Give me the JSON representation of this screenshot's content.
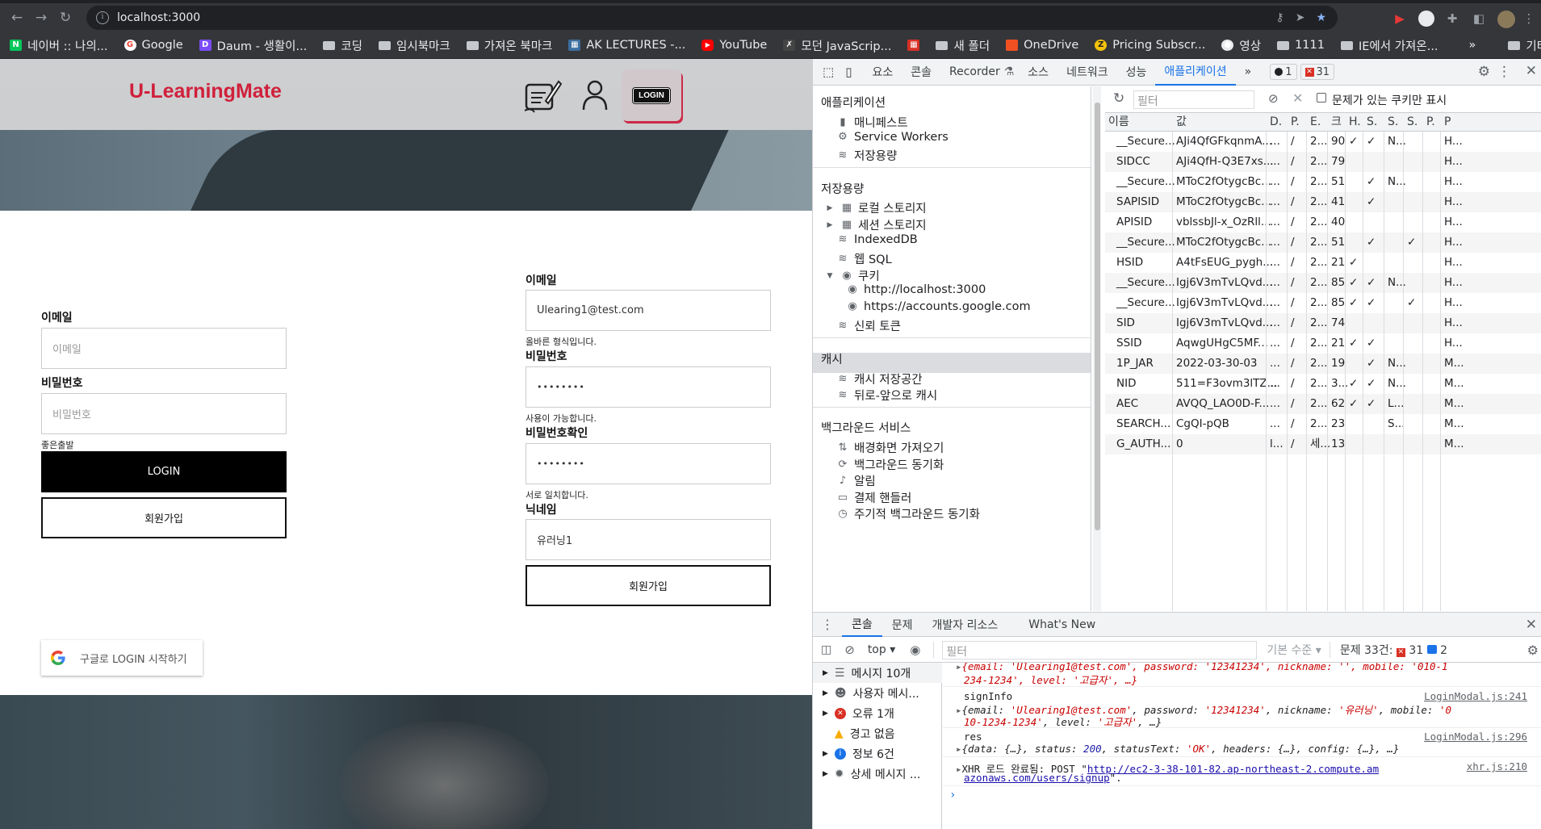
{
  "browser": {
    "url": "localhost:3000",
    "bookmarks": [
      {
        "label": "네이버 :: 나의...",
        "icon": "naver-icon"
      },
      {
        "label": "Google",
        "icon": "google-icon"
      },
      {
        "label": "Daum - 생활이...",
        "icon": "daum-icon"
      },
      {
        "label": "코딩",
        "icon": "folder-icon"
      },
      {
        "label": "임시북마크",
        "icon": "folder-icon"
      },
      {
        "label": "가져온 북마크",
        "icon": "folder-icon"
      },
      {
        "label": "AK LECTURES -...",
        "icon": "ak-icon"
      },
      {
        "label": "YouTube",
        "icon": "youtube-icon"
      },
      {
        "label": "모던 JavaScrip...",
        "icon": "js-icon"
      },
      {
        "label": "",
        "icon": "red-pattern-icon"
      },
      {
        "label": "새 폴더",
        "icon": "folder-icon"
      },
      {
        "label": "OneDrive",
        "icon": "microsoft-icon"
      },
      {
        "label": "Pricing Subscr...",
        "icon": "z-icon"
      },
      {
        "label": "영상",
        "icon": "globe-icon"
      },
      {
        "label": "1111",
        "icon": "folder-icon"
      },
      {
        "label": "IE에서 가져온...",
        "icon": "folder-icon"
      }
    ],
    "more_bookmarks": "»",
    "other_bookmarks": "기타 북마크"
  },
  "site": {
    "logo": "U-LearningMate",
    "login_badge": "LOGIN"
  },
  "login_form": {
    "email_label": "이메일",
    "email_placeholder": "이메일",
    "password_label": "비밀번호",
    "password_placeholder": "비밀번호",
    "hint": "좋은출발",
    "login_button": "LOGIN",
    "signup_button": "회원가입",
    "google_button": "구글로 LOGIN 시작하기"
  },
  "signup_form": {
    "email_label": "이메일",
    "email_value": "Ulearing1@test.com",
    "email_hint": "올바른 형식입니다.",
    "password_label": "비밀번호",
    "password_value": "••••••••",
    "password_hint": "사용이 가능합니다.",
    "confirm_label": "비밀번호확인",
    "confirm_value": "••••••••",
    "confirm_hint": "서로 일치합니다.",
    "nickname_label": "닉네임",
    "nickname_value": "유러닝1",
    "submit_button": "회원가입"
  },
  "devtools": {
    "tabs": [
      "요소",
      "콘솔",
      "Recorder",
      "소스",
      "네트워크",
      "성능",
      "애플리케이션"
    ],
    "active_tab": "애플리케이션",
    "more": "»",
    "info_count": "1",
    "error_count": "31",
    "sidebar": {
      "app_section": "애플리케이션",
      "app_items": [
        "매니페스트",
        "Service Workers",
        "저장용량"
      ],
      "storage_section": "저장용량",
      "storage_items": [
        "로컬 스토리지",
        "세션 스토리지",
        "IndexedDB",
        "웹 SQL",
        "쿠키"
      ],
      "cookie_items": [
        "http://localhost:3000",
        "https://accounts.google.com"
      ],
      "trust_token": "신뢰 토큰",
      "cache_section": "캐시",
      "cache_items": [
        "캐시 저장공간",
        "뒤로-앞으로 캐시"
      ],
      "bg_section": "백그라운드 서비스",
      "bg_items": [
        "배경화면 가져오기",
        "백그라운드 동기화",
        "알림",
        "결제 핸들러",
        "주기적 백그라운드 동기화"
      ]
    },
    "cookies": {
      "filter_placeholder": "필터",
      "only_issues_label": "문제가 있는 쿠키만 표시",
      "columns": [
        "이름",
        "값",
        "D.",
        "P.",
        "E.",
        "크",
        "H.",
        "S.",
        "S.",
        "S.",
        "P.",
        "P"
      ],
      "rows": [
        [
          "__Secure...",
          "AJi4QfGFkqnmA...",
          "...",
          "/",
          "2...",
          "90",
          "✓",
          "✓",
          "N...",
          "",
          "",
          "H..."
        ],
        [
          "SIDCC",
          "AJi4QfH-Q3E7xs...",
          "...",
          "/",
          "2...",
          "79",
          "",
          "",
          "",
          "",
          "",
          "H..."
        ],
        [
          "__Secure...",
          "MToC2fOtygcBc...",
          "...",
          "/",
          "2...",
          "51",
          "",
          "✓",
          "N...",
          "",
          "",
          "H..."
        ],
        [
          "SAPISID",
          "MToC2fOtygcBc...",
          "...",
          "/",
          "2...",
          "41",
          "",
          "✓",
          "",
          "",
          "",
          "H..."
        ],
        [
          "APISID",
          "vblssbJl-x_OzRll...",
          "...",
          "/",
          "2...",
          "40",
          "",
          "",
          "",
          "",
          "",
          "H..."
        ],
        [
          "__Secure...",
          "MToC2fOtygcBc...",
          "...",
          "/",
          "2...",
          "51",
          "",
          "✓",
          "",
          "✓",
          "",
          "H..."
        ],
        [
          "HSID",
          "A4tFsEUG_pygh...",
          "...",
          "/",
          "2...",
          "21",
          "✓",
          "",
          "",
          "",
          "",
          "H..."
        ],
        [
          "__Secure...",
          "Igj6V3mTvLQvd...",
          "...",
          "/",
          "2...",
          "85",
          "✓",
          "✓",
          "N...",
          "",
          "",
          "H..."
        ],
        [
          "__Secure...",
          "Igj6V3mTvLQvd...",
          "...",
          "/",
          "2...",
          "85",
          "✓",
          "✓",
          "",
          "✓",
          "",
          "H..."
        ],
        [
          "SID",
          "Igj6V3mTvLQvd...",
          "...",
          "/",
          "2...",
          "74",
          "",
          "",
          "",
          "",
          "",
          "H..."
        ],
        [
          "SSID",
          "AqwgUHgC5MF...",
          "...",
          "/",
          "2...",
          "21",
          "✓",
          "✓",
          "",
          "",
          "",
          "H..."
        ],
        [
          "1P_JAR",
          "2022-03-30-03",
          "...",
          "/",
          "2...",
          "19",
          "",
          "✓",
          "N...",
          "",
          "",
          "M..."
        ],
        [
          "NID",
          "511=F3ovm3lTZ...",
          "...",
          "/",
          "2...",
          "3...",
          "✓",
          "✓",
          "N...",
          "",
          "",
          "M..."
        ],
        [
          "AEC",
          "AVQQ_LAO0D-F...",
          "...",
          "/",
          "2...",
          "62",
          "✓",
          "✓",
          "L...",
          "",
          "",
          "M..."
        ],
        [
          "SEARCH...",
          "CgQI-pQB",
          "...",
          "/",
          "2...",
          "23",
          "",
          "",
          "S...",
          "",
          "",
          "M..."
        ],
        [
          "G_AUTH...",
          "0",
          "l...",
          "/",
          "세...",
          "13",
          "",
          "",
          "",
          "",
          "",
          "M..."
        ]
      ]
    },
    "drawer": {
      "tabs": [
        "콘솔",
        "문제",
        "개발자 리소스",
        "What's New"
      ],
      "context": "top",
      "filter_placeholder": "필터",
      "level": "기본 수준",
      "issues_label": "문제 33건:",
      "issues_errors": "31",
      "issues_info": "2",
      "side_items": [
        "메시지 10개",
        "사용자 메시...",
        "오류 1개",
        "경고 없음",
        "정보 6건",
        "상세 메시지 ..."
      ],
      "console_lines": {
        "l0a": "{email: 'Ulearing1@test.com', password: '12341234', nickname: '', mobile: '010-1",
        "l0b": "234-1234', level: '고급자', …}",
        "signinfo": "signInfo",
        "signinfo_src": "LoginModal.js:241",
        "l1a_1": "{email: ",
        "l1a_2": "'Ulearing1@test.com'",
        "l1a_3": ", password: ",
        "l1a_4": "'12341234'",
        "l1a_5": ", nickname: ",
        "l1a_6": "'유러닝'",
        "l1a_7": ", mobile: ",
        "l1a_8": "'0",
        "l1b_1": "10-1234-1234'",
        "l1b_2": ", level: ",
        "l1b_3": "'고급자'",
        "l1b_4": ", …}",
        "res": "res",
        "res_src": "LoginModal.js:296",
        "res_obj_1": "{data: {…}, status: ",
        "res_obj_2": "200",
        "res_obj_3": ", statusText: ",
        "res_obj_4": "'OK'",
        "res_obj_5": ", headers: {…}, config: {…}, …}",
        "xhr_1": "XHR 로드 완료됨: POST \"",
        "xhr_2": "http://ec2-3-38-101-82.ap-northeast-2.compute.am",
        "xhr_src": "xhr.js:210",
        "xhr_3": "azonaws.com/users/signup",
        "xhr_4": "\"."
      }
    }
  }
}
